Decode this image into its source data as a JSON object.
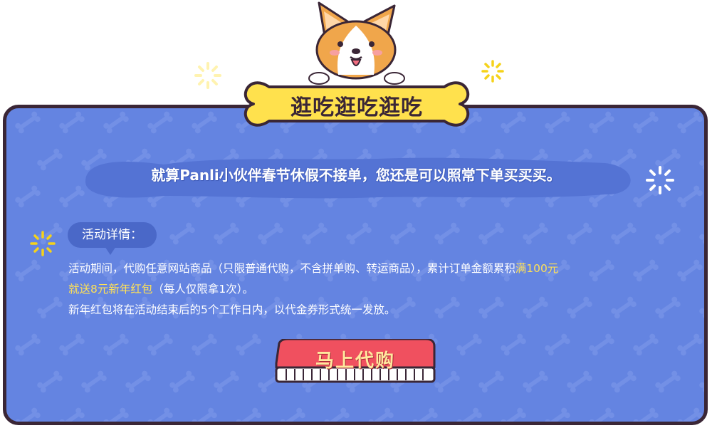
{
  "banner": {
    "title": "逛吃逛吃逛吃"
  },
  "headline": "就算Panli小伙伴春节休假不接单，您还是可以照常下单买买买。",
  "details": {
    "tag": "活动详情：",
    "line1_prefix": "活动期间，代购任意网站商品（只限普通代购，不含拼单购、转运商品），累计订单金额累积",
    "line1_highlight": "满100元",
    "line2_highlight": "就送8元新年红包",
    "line2_suffix": "（每人仅限拿1次）。",
    "line3": "新年红包将在活动结束后的5个工作日内，以代金券形式统一发放。"
  },
  "cta": {
    "label": "马上代购"
  },
  "colors": {
    "panel": "#6484e1",
    "border": "#3a2636",
    "bone": "#ffe14d",
    "highlight": "#ffe156",
    "button": "#f0505f"
  }
}
